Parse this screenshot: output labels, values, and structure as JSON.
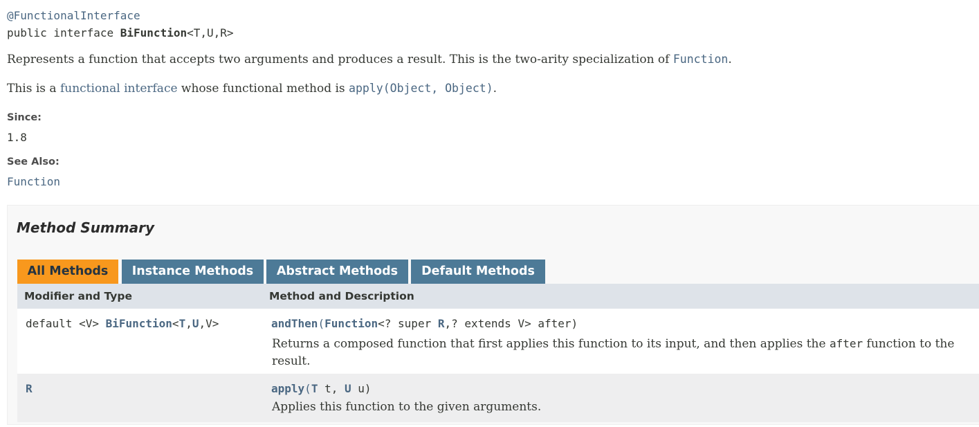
{
  "declaration": {
    "annotation": "@FunctionalInterface",
    "signature_prefix": "public interface ",
    "type_name": "BiFunction",
    "type_params": "<T,U,R>"
  },
  "description": {
    "line1_text": "Represents a function that accepts two arguments and produces a result. This is the two-arity specialization of ",
    "line1_link": "Function",
    "line1_end": ".",
    "line2_prefix": "This is a ",
    "line2_link": "functional interface",
    "line2_middle": " whose functional method is ",
    "line2_method": "apply(Object, Object)",
    "line2_end": "."
  },
  "since": {
    "label": "Since:",
    "value": "1.8"
  },
  "see_also": {
    "label": "See Also:",
    "link": "Function"
  },
  "method_summary": {
    "title": "Method Summary",
    "tabs": [
      "All Methods",
      "Instance Methods",
      "Abstract Methods",
      "Default Methods"
    ],
    "active_tab": "All Methods",
    "columns": [
      "Modifier and Type",
      "Method and Description"
    ],
    "rows": [
      {
        "modifier_prefix": "default <V> ",
        "return_type": "BiFunction",
        "return_params_open": "<",
        "return_param_t": "T",
        "return_comma1": ",",
        "return_param_u": "U",
        "return_comma2": ",",
        "return_param_v": "V>",
        "method_name": "andThen",
        "method_paren": "(",
        "param_type": "Function",
        "param_mid": "<? super ",
        "param_r": "R",
        "param_rest": ",? extends V> after)",
        "desc_part1": "Returns a composed function that first applies this function to its input, and then applies the ",
        "desc_code": "after",
        "desc_part2": " function to the",
        "desc_line2": "result."
      },
      {
        "modifier": "R",
        "method_name": "apply",
        "method_paren": "(",
        "p1_type": "T",
        "p1_name": " t, ",
        "p2_type": "U",
        "p2_name": " u)",
        "description": "Applies this function to the given arguments."
      }
    ]
  },
  "colors": {
    "link": "#4A6782",
    "tab": "#4D7A97",
    "tab_active": "#F8981D",
    "header_bg": "#dee3e9",
    "alt_row": "#eeeeef"
  }
}
